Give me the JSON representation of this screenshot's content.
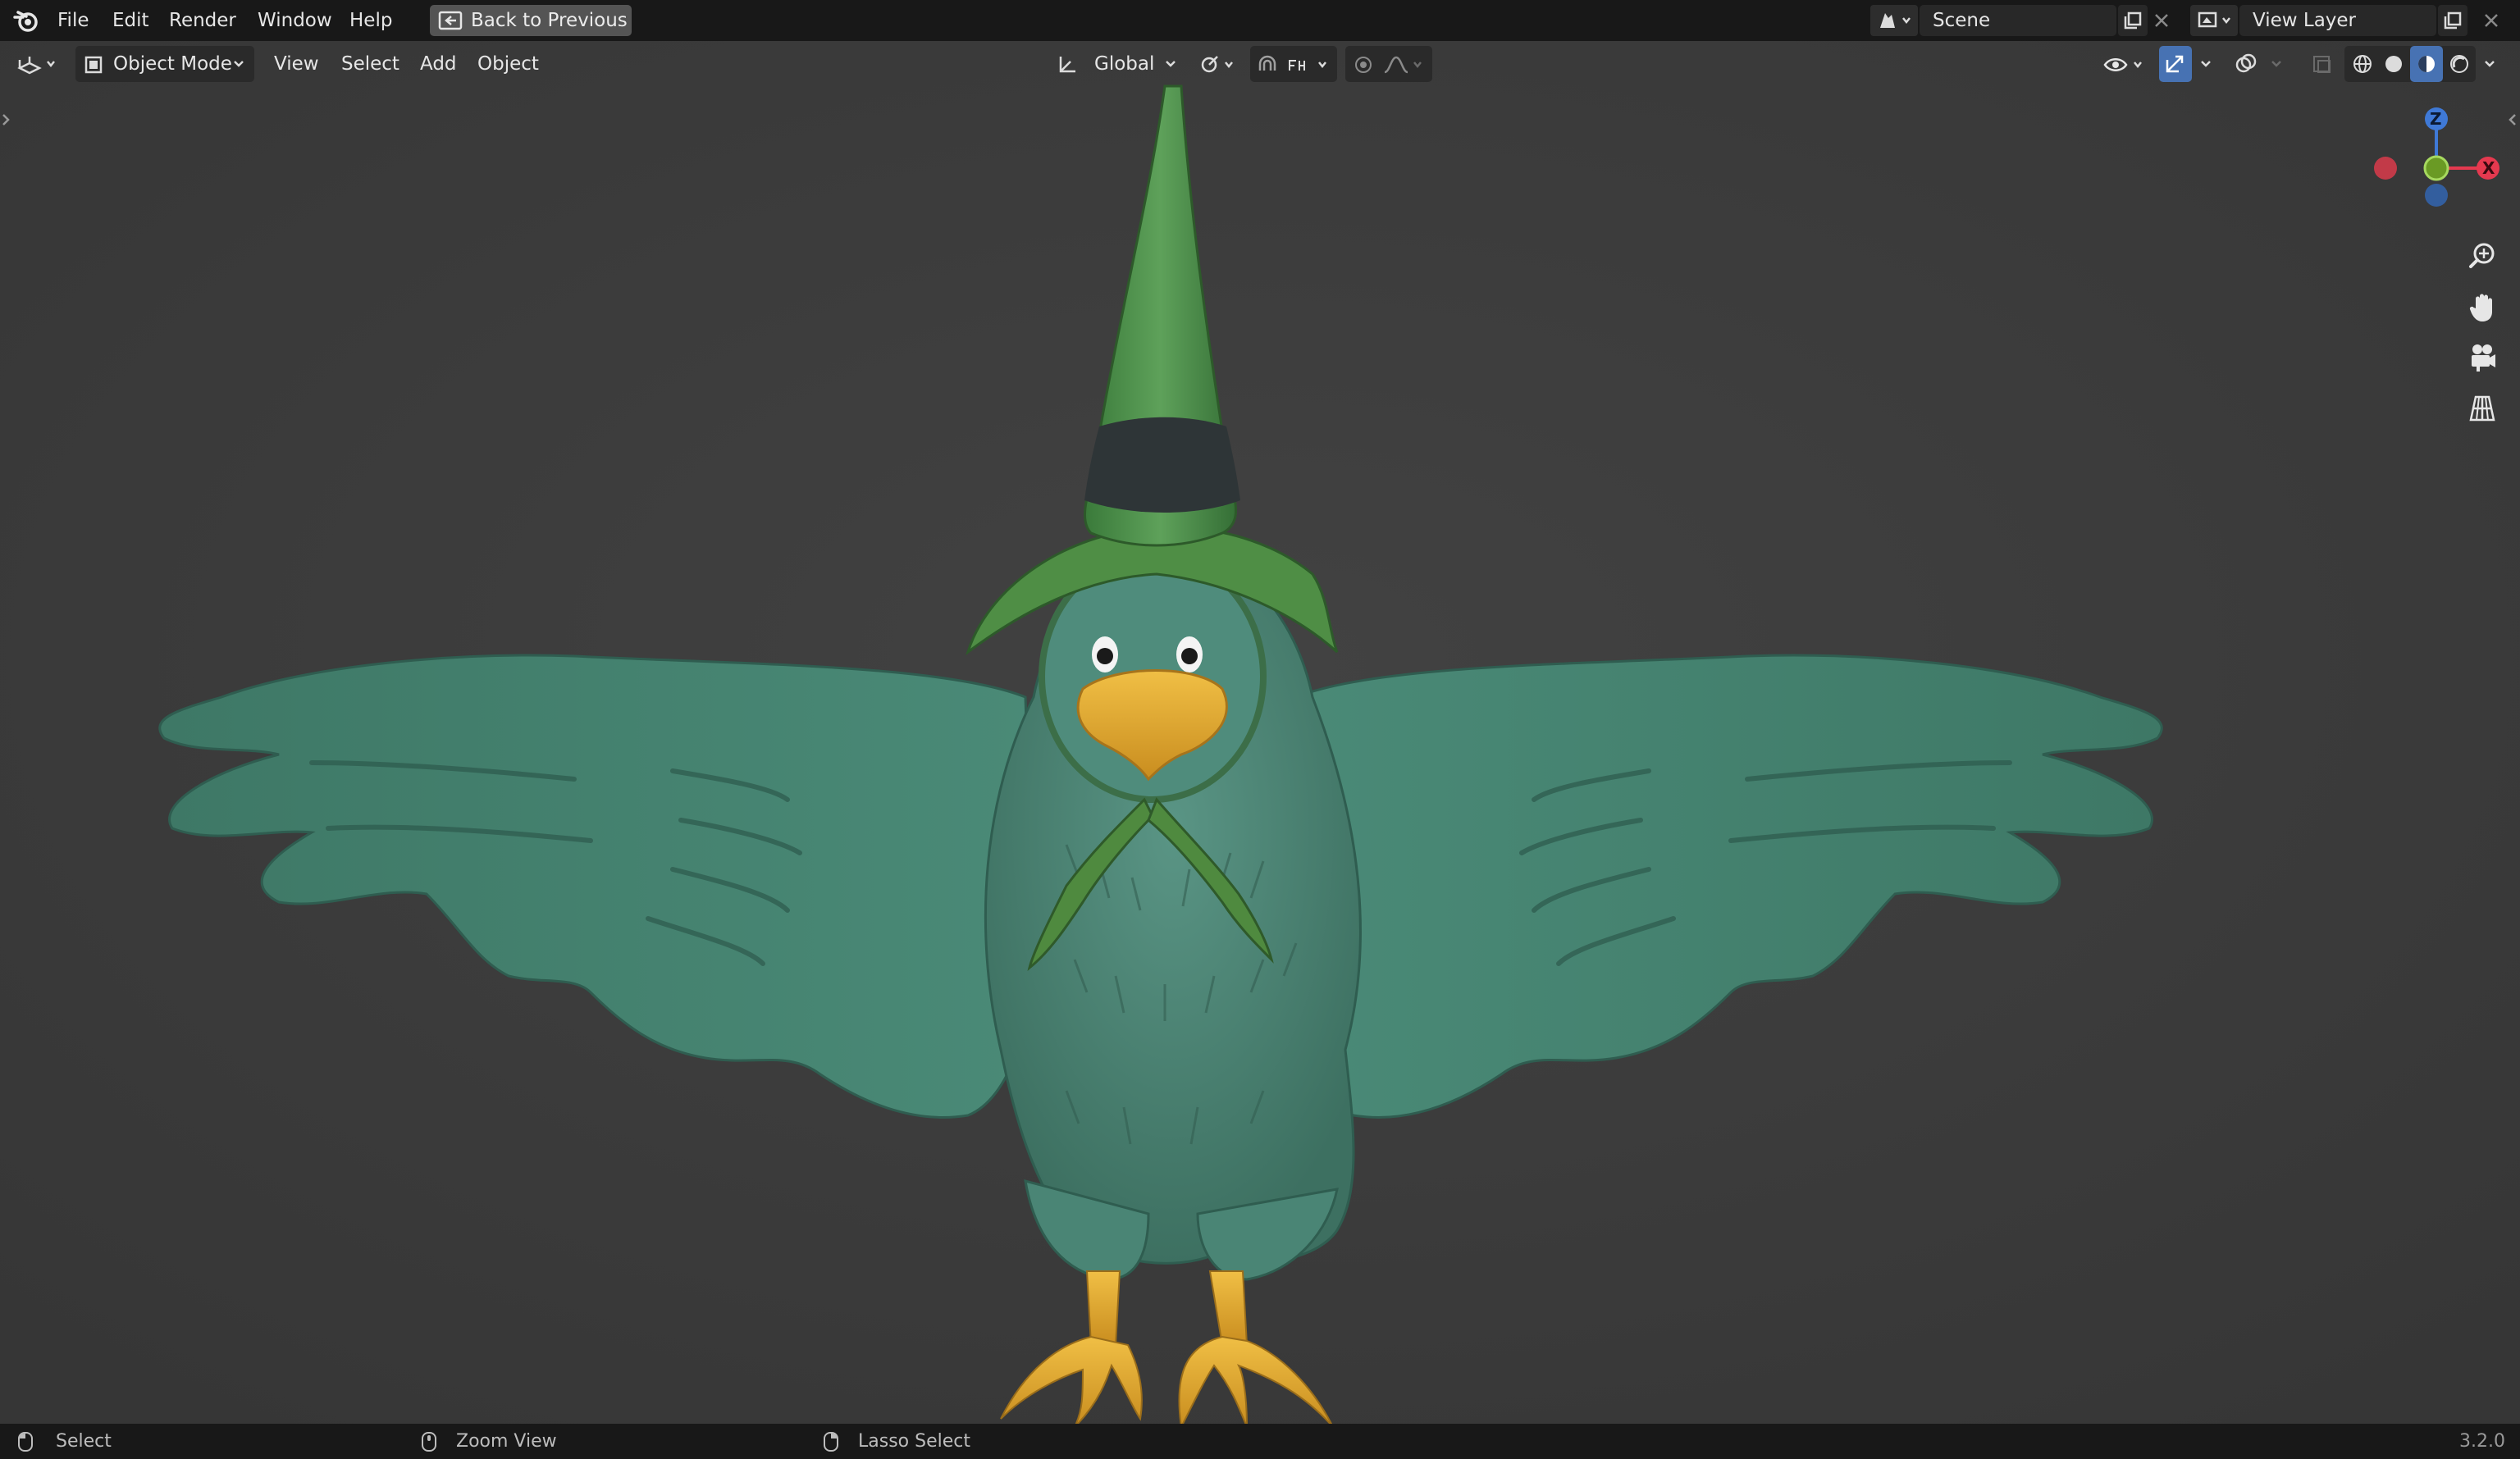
{
  "menubar": {
    "items": [
      "File",
      "Edit",
      "Render",
      "Window",
      "Help"
    ],
    "back_button": "Back to Previous",
    "scene_label": "Scene",
    "view_layer_label": "View Layer"
  },
  "header": {
    "mode": "Object Mode",
    "menus": [
      "View",
      "Select",
      "Add",
      "Object"
    ],
    "orientation": "Global"
  },
  "gizmo": {
    "x_label": "X",
    "z_label": "Z"
  },
  "status": {
    "select": "Select",
    "zoom": "Zoom View",
    "lasso": "Lasso Select",
    "version": "3.2.0"
  },
  "icons": {
    "logo": "blender-logo-icon",
    "navigation": [
      "zoom-icon",
      "pan-hand-icon",
      "camera-icon",
      "grid-view-icon"
    ]
  },
  "colors": {
    "topbar": "#181818",
    "viewport": "#3d3d3d",
    "accent_blue": "#4772b3",
    "axis_x": "#e5394f",
    "axis_y": "#7fb32b",
    "axis_z": "#3f79d6"
  }
}
